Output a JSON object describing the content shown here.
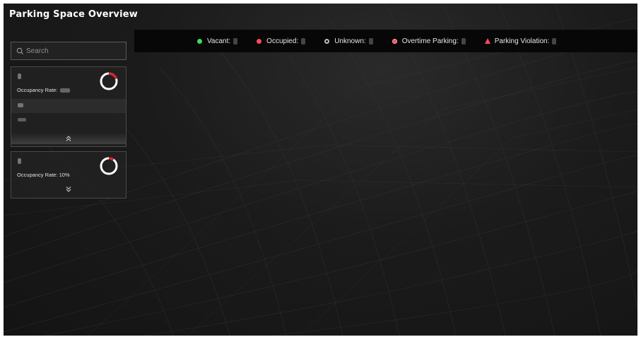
{
  "page": {
    "title": "Parking Space Overview"
  },
  "status_bar": {
    "items": [
      {
        "label": "Vacant",
        "sep": ":",
        "color": "#3ddc5a",
        "icon": "green-dot-icon"
      },
      {
        "label": "Occupied",
        "sep": ":",
        "color": "#ff4a5a",
        "icon": "red-dot-icon"
      },
      {
        "label": "Unknown",
        "sep": ":",
        "color": "#bdbdbd",
        "icon": "gray-ring-icon"
      },
      {
        "label": "Overtime Parking",
        "sep": ":",
        "color": "#ff4a5a",
        "icon": "red-ring-dot-icon"
      },
      {
        "label": "Parking Violation",
        "sep": ":",
        "color": "#ff4a5a",
        "icon": "warning-triangle-icon"
      }
    ]
  },
  "search": {
    "placeholder": "Search",
    "icon": "search-icon"
  },
  "cards": [
    {
      "rate_label": "Occupancy Rate:",
      "rate_value": "",
      "occupancy_fraction": 0.2,
      "expanded": true,
      "toggle_icon": "chevron-double-up-icon"
    },
    {
      "rate_label": "Occupancy Rate:",
      "rate_value": "10%",
      "occupancy_fraction": 0.1,
      "expanded": false,
      "toggle_icon": "chevron-double-down-icon"
    }
  ],
  "colors": {
    "occupied_arc": "#e0202a",
    "vacant_arc": "#ffffff",
    "status_bar_bg": "#070707"
  }
}
